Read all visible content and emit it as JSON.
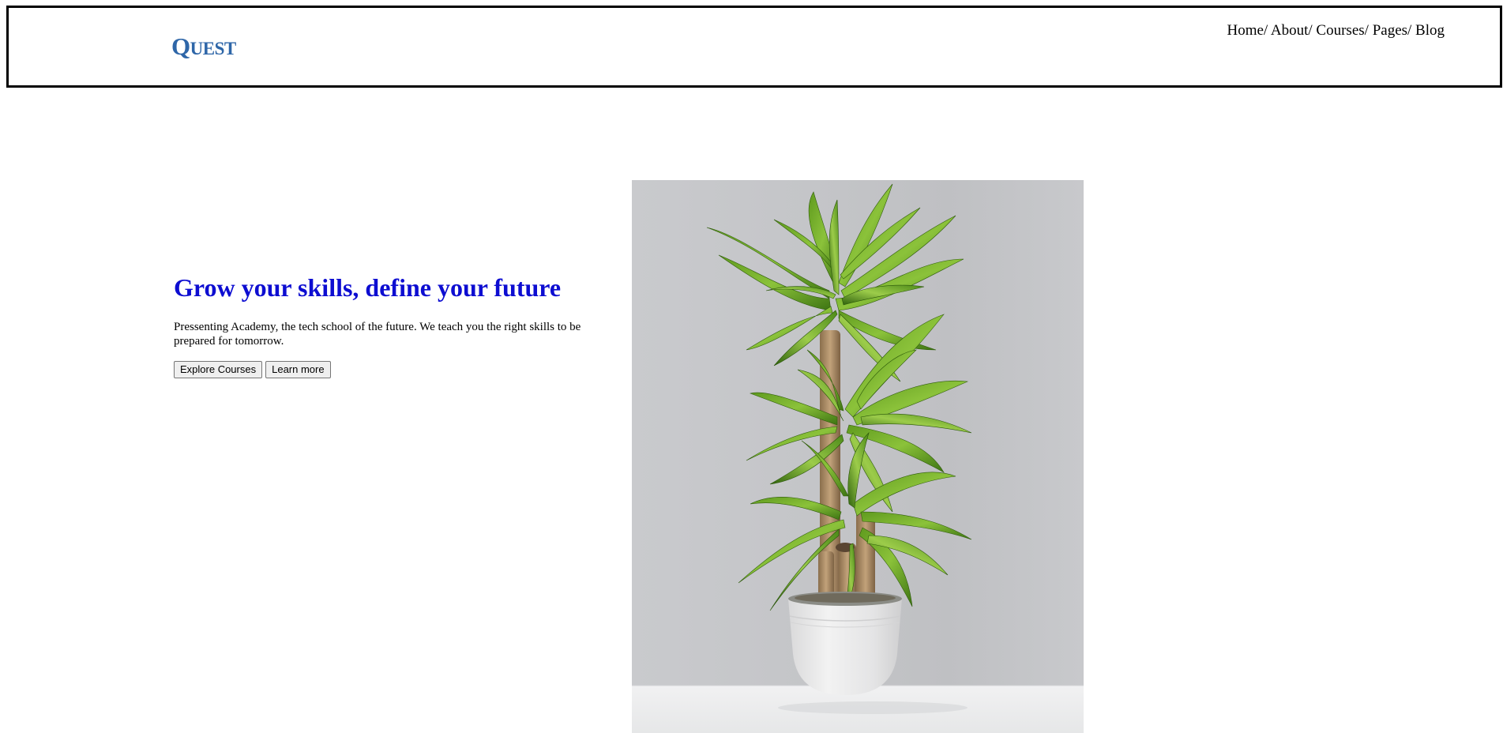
{
  "header": {
    "logo": {
      "first": "Q",
      "rest": "UEST"
    },
    "nav": [
      {
        "label": "Home",
        "sep": "/ "
      },
      {
        "label": "About",
        "sep": "/ "
      },
      {
        "label": "Courses",
        "sep": "/ "
      },
      {
        "label": "Pages",
        "sep": "/ "
      },
      {
        "label": "Blog",
        "sep": ""
      }
    ]
  },
  "hero": {
    "title": "Grow your skills, define your future",
    "description": "Pressenting Academy, the tech school of the future. We teach you the right skills to be prepared for tomorrow.",
    "buttons": {
      "explore": "Explore Courses",
      "learn_more": "Learn more"
    },
    "image": {
      "icon": "potted-plant-photo"
    }
  },
  "colors": {
    "logo": "#2e66a8",
    "title": "#0d0dd1",
    "border": "#000000"
  }
}
